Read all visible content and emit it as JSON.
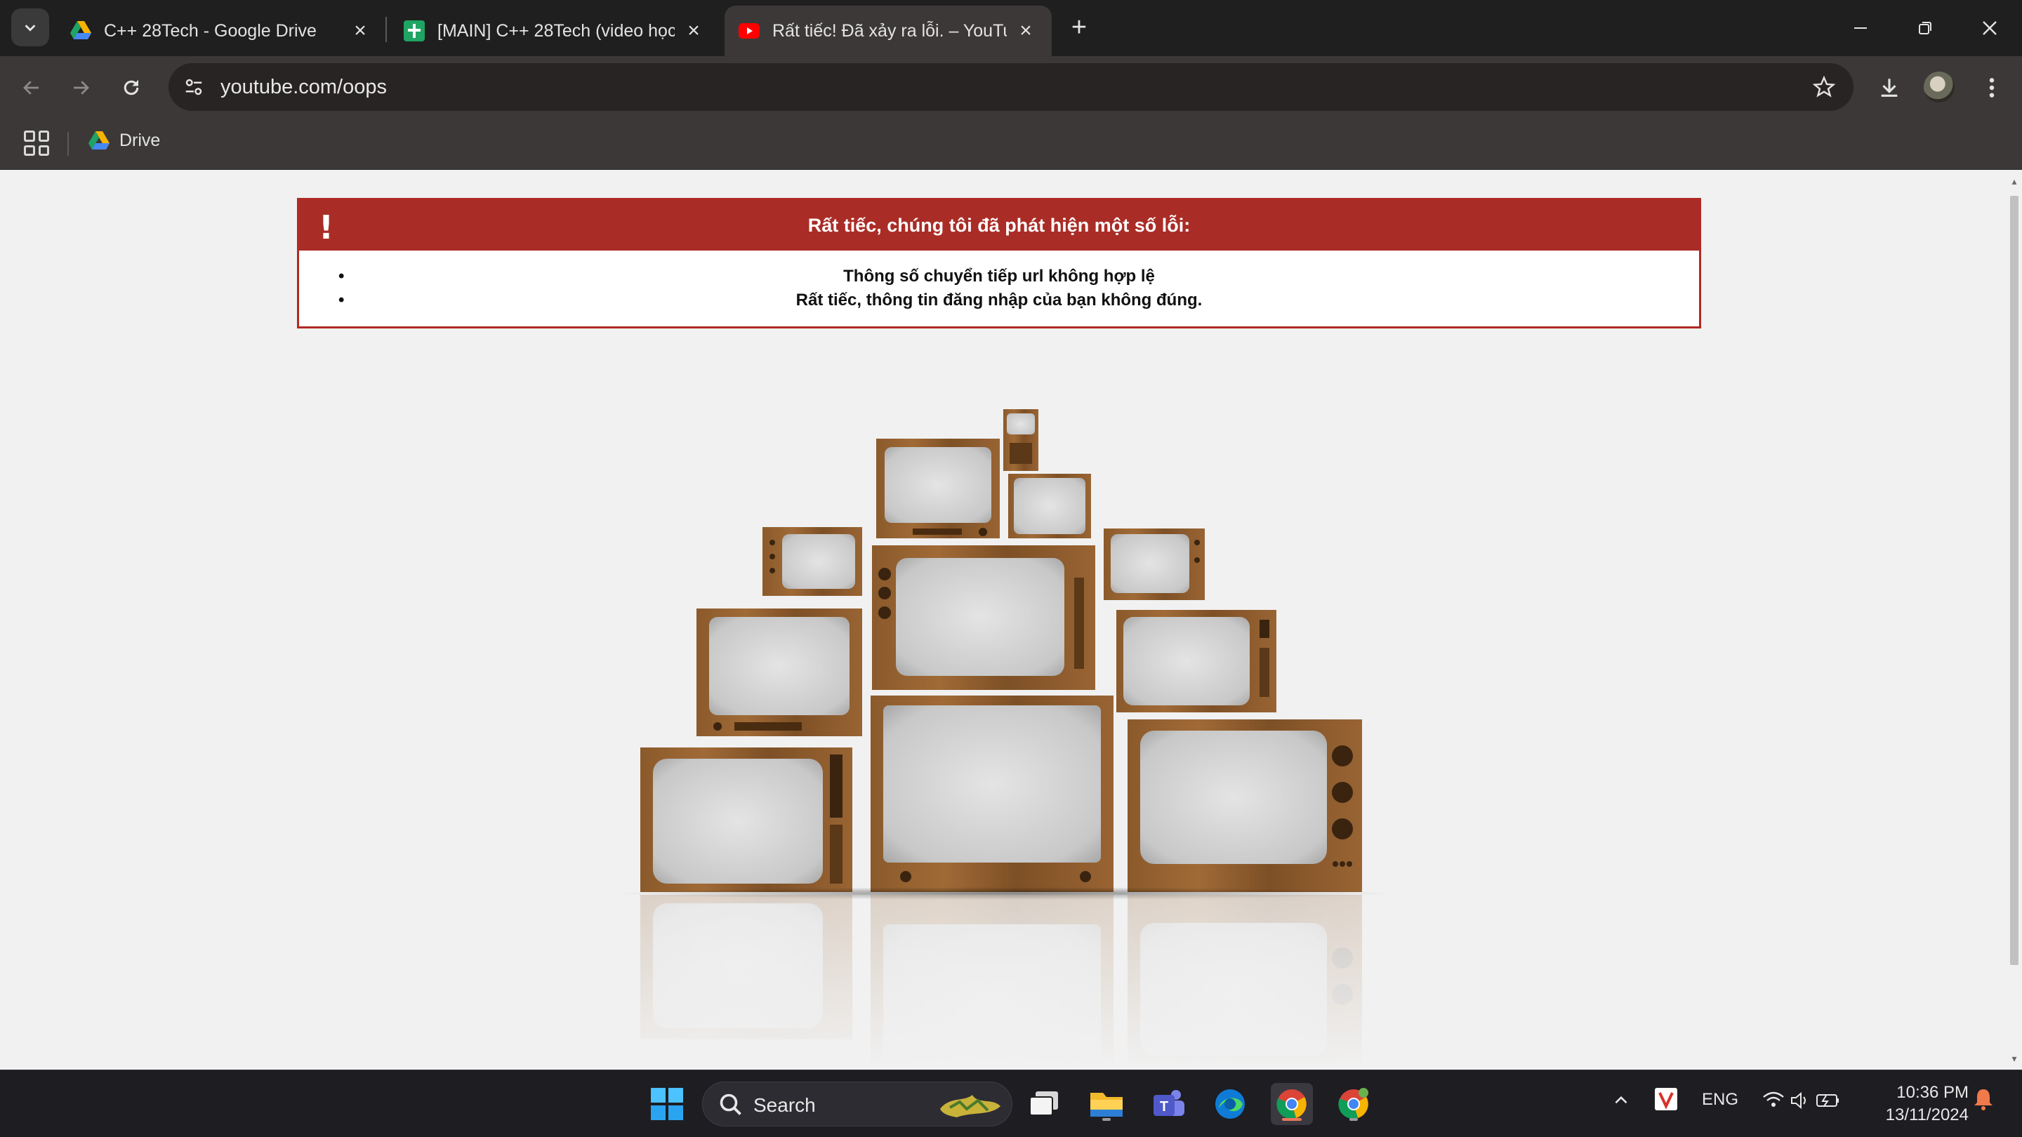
{
  "browser": {
    "tabs": [
      {
        "title": "C++ 28Tech - Google Drive",
        "icon": "google-drive-icon"
      },
      {
        "title": "[MAIN] C++ 28Tech (video học",
        "icon": "google-sheets-icon"
      },
      {
        "title": "Rất tiếc! Đã xảy ra lỗi. – YouTub",
        "icon": "youtube-icon",
        "active": true
      }
    ],
    "url": "youtube.com/oops",
    "bookmarks": [
      {
        "label": "Drive",
        "icon": "google-drive-icon"
      }
    ]
  },
  "error": {
    "heading": "Rất tiếc, chúng tôi đã phát hiện một số lỗi:",
    "icon": "!",
    "items": [
      "Thông số chuyển tiếp url không hợp lệ",
      "Rất tiếc, thông tin đăng nhập của bạn không đúng."
    ]
  },
  "taskbar": {
    "search_label": "Search",
    "language": "ENG",
    "time": "10:36 PM",
    "date": "13/11/2024"
  },
  "colors": {
    "error_red": "#aa2c26",
    "tab_active": "#3c3838",
    "titlebar": "#1f1f1f",
    "wood": "#8a5a2c"
  }
}
